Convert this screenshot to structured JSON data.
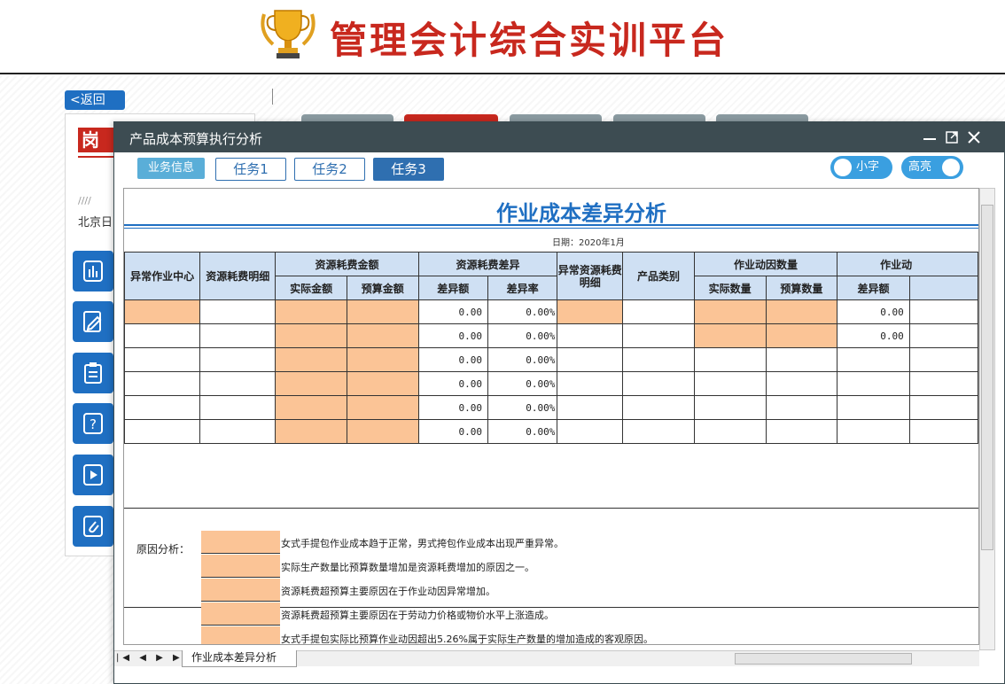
{
  "header": {
    "app_title": "管理会计综合实训平台",
    "trophy_icon": "trophy-icon"
  },
  "background": {
    "back_label": "<返回",
    "post_tag": "岗位",
    "slashes": "////",
    "date_text": "北京日"
  },
  "modal": {
    "title": "产品成本预算执行分析",
    "tabs": [
      {
        "label": "业务信息"
      },
      {
        "label": "任务1"
      },
      {
        "label": "任务2"
      },
      {
        "label": "任务3",
        "active": true
      }
    ],
    "toggles": {
      "small_font": "小字",
      "highlight": "高亮"
    }
  },
  "sheet": {
    "title": "作业成本差异分析",
    "date": "日期：2020年1月",
    "headers": {
      "abnormal_center": "异常作业中心",
      "resource_detail": "资源耗费明细",
      "resource_amount": "资源耗费金额",
      "actual_amount": "实际金额",
      "budget_amount": "预算金额",
      "resource_variance": "资源耗费差异",
      "variance_amount": "差异额",
      "variance_rate": "差异率",
      "abnormal_resource_detail": "异常资源耗费明细",
      "product_category": "产品类别",
      "driver_quantity": "作业动因数量",
      "actual_qty": "实际数量",
      "budget_qty": "预算数量",
      "driver_cut": "作业动",
      "variance_cut": "差异额"
    },
    "rows": [
      {
        "variance": "0.00",
        "rate": "0.00%",
        "driver_variance": "0.00"
      },
      {
        "variance": "0.00",
        "rate": "0.00%",
        "driver_variance": "0.00"
      },
      {
        "variance": "0.00",
        "rate": "0.00%",
        "driver_variance": ""
      },
      {
        "variance": "0.00",
        "rate": "0.00%",
        "driver_variance": ""
      },
      {
        "variance": "0.00",
        "rate": "0.00%",
        "driver_variance": ""
      },
      {
        "variance": "0.00",
        "rate": "0.00%",
        "driver_variance": ""
      }
    ],
    "reason_label": "原因分析：",
    "reasons": [
      "女式手提包作业成本趋于正常，男式挎包作业成本出现严重异常。",
      "实际生产数量比预算数量增加是资源耗费增加的原因之一。",
      "资源耗费超预算主要原因在于作业动因异常增加。",
      "资源耗费超预算主要原因在于劳动力价格或物价水平上涨造成。",
      "女式手提包实际比预算作业动因超出5.26%属于实际生产数量的增加造成的客观原因。"
    ],
    "sheet_tab": "作业成本差异分析",
    "nav_buttons": "|◀ ◀ ▶ ▶|"
  },
  "colors": {
    "accent_blue": "#1f6fc2",
    "input_orange": "#fbc496",
    "header_blue": "#cfe0f3",
    "title_red": "#c8281e",
    "titlebar": "#3d4c52"
  }
}
